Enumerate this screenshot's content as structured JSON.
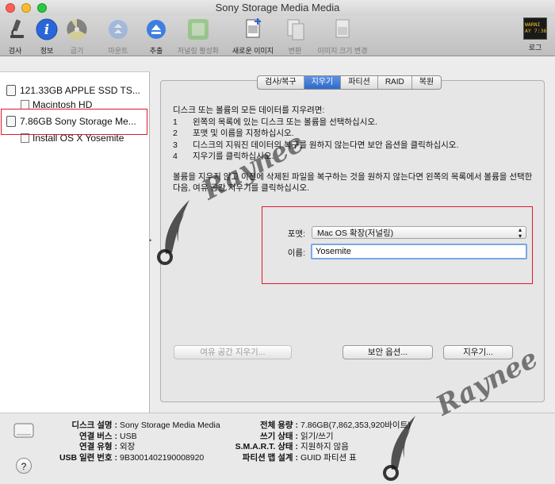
{
  "window": {
    "title": "Sony Storage Media Media"
  },
  "toolbar": {
    "items": [
      {
        "label": "검사",
        "icon": "microscope-icon",
        "enabled": true
      },
      {
        "label": "정보",
        "icon": "info-icon",
        "enabled": true
      },
      {
        "label": "굽기",
        "icon": "burn-icon",
        "enabled": false
      },
      {
        "label": "마운트",
        "icon": "mount-icon",
        "enabled": false
      },
      {
        "label": "추출",
        "icon": "eject-icon",
        "enabled": true
      },
      {
        "label": "저널링 활성화",
        "icon": "journal-icon",
        "enabled": false
      },
      {
        "label": "새로운 이미지",
        "icon": "new-image-icon",
        "enabled": true
      },
      {
        "label": "변환",
        "icon": "convert-icon",
        "enabled": false
      },
      {
        "label": "이미지 크기 변경",
        "icon": "resize-image-icon",
        "enabled": false
      },
      {
        "label": "로그",
        "icon": "log-icon",
        "enabled": true,
        "screen_text": "WARNI\nAY 7:36"
      }
    ]
  },
  "sidebar": {
    "items": [
      {
        "label": "121.33GB APPLE SSD TS...",
        "type": "disk"
      },
      {
        "label": "Macintosh HD",
        "type": "volume"
      },
      {
        "label": "7.86GB Sony Storage Me...",
        "type": "disk",
        "selected": true
      },
      {
        "label": "Install OS X Yosemite",
        "type": "volume"
      }
    ]
  },
  "tabs": [
    {
      "label": "검사/복구",
      "active": false
    },
    {
      "label": "지우기",
      "active": true
    },
    {
      "label": "파티션",
      "active": false
    },
    {
      "label": "RAID",
      "active": false
    },
    {
      "label": "복원",
      "active": false
    }
  ],
  "erase": {
    "intro": "디스크 또는 볼륨의 모든 데이터를 지우려면:",
    "steps": [
      {
        "n": "1",
        "text": "왼쪽의 목록에 있는 디스크 또는 볼륨을 선택하십시오."
      },
      {
        "n": "2",
        "text": "포맷 및 이름을 지정하십시오."
      },
      {
        "n": "3",
        "text": "디스크의 지워진 데이터의 복구를 원하지 않는다면 보안 옵션을 클릭하십시오."
      },
      {
        "n": "4",
        "text": "지우기를 클릭하십시오."
      }
    ],
    "note": "볼륨을 지우지 않고 이전에 삭제된 파일을 복구하는 것을 원하지 않는다면 왼쪽의 목록에서 볼륨을 선택한 다음, 여유 공간 지우기를 클릭하십시오.",
    "format_label": "포맷:",
    "format_value": "Mac OS 확장(저널링)",
    "name_label": "이름:",
    "name_value": "Yosemite",
    "erase_free_space_button": "여유 공간 지우기...",
    "security_options_button": "보안 옵션...",
    "erase_button": "지우기..."
  },
  "info": {
    "left": [
      {
        "k": "디스크 설명 :",
        "v": "Sony Storage Media Media"
      },
      {
        "k": "연결 버스 :",
        "v": "USB"
      },
      {
        "k": "연결 유형 :",
        "v": "외장"
      },
      {
        "k": "USB 일련 번호 :",
        "v": "9B3001402190008920"
      }
    ],
    "right": [
      {
        "k": "전체 용량 :",
        "v": "7.86GB(7,862,353,920바이트)"
      },
      {
        "k": "쓰기 상태 :",
        "v": "읽기/쓰기"
      },
      {
        "k": "S.M.A.R.T. 상태 :",
        "v": "지원하지 않음"
      },
      {
        "k": "파티션 맵 설계 :",
        "v": "GUID 파티션 표"
      }
    ]
  },
  "help": {
    "label": "?"
  },
  "watermark": {
    "text": "Raynee"
  },
  "colors": {
    "highlight": "#e0182d",
    "tab_active": "#3a74d1",
    "input_focus": "#7aa7e8"
  }
}
